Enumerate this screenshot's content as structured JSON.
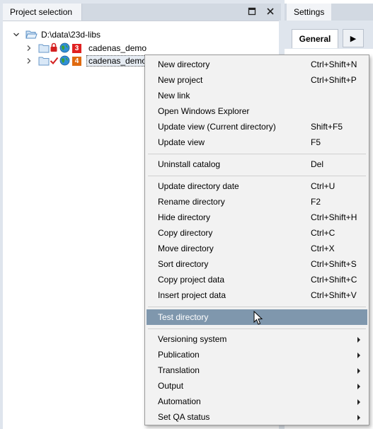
{
  "project_panel": {
    "title": "Project selection",
    "pin_icon": "maximize-icon",
    "close_icon": "close-icon",
    "tree": {
      "root": "D:\\data\\23d-libs",
      "items": [
        {
          "label": "cadenas_demo",
          "badge": "3",
          "badge_color": "#e02020"
        },
        {
          "label": "cadenas_demo",
          "badge": "4",
          "badge_color": "#e06a10"
        }
      ]
    }
  },
  "settings_panel": {
    "title": "Settings",
    "tab_general": "General",
    "tab_more": "▶"
  },
  "context_menu": {
    "group1": [
      {
        "label": "New directory",
        "shortcut": "Ctrl+Shift+N"
      },
      {
        "label": "New project",
        "shortcut": "Ctrl+Shift+P"
      },
      {
        "label": "New link",
        "shortcut": ""
      },
      {
        "label": "Open Windows Explorer",
        "shortcut": ""
      },
      {
        "label": "Update view (Current directory)",
        "shortcut": "Shift+F5"
      },
      {
        "label": "Update view",
        "shortcut": "F5"
      }
    ],
    "group2": [
      {
        "label": "Uninstall catalog",
        "shortcut": "Del"
      }
    ],
    "group3": [
      {
        "label": "Update directory date",
        "shortcut": "Ctrl+U"
      },
      {
        "label": "Rename directory",
        "shortcut": "F2"
      },
      {
        "label": "Hide directory",
        "shortcut": "Ctrl+Shift+H"
      },
      {
        "label": "Copy directory",
        "shortcut": "Ctrl+C"
      },
      {
        "label": "Move directory",
        "shortcut": "Ctrl+X"
      },
      {
        "label": "Sort directory",
        "shortcut": "Ctrl+Shift+S"
      },
      {
        "label": "Copy project data",
        "shortcut": "Ctrl+Shift+C"
      },
      {
        "label": "Insert project data",
        "shortcut": "Ctrl+Shift+V"
      }
    ],
    "group4": [
      {
        "label": "Test directory",
        "shortcut": ""
      }
    ],
    "group5": [
      {
        "label": "Versioning system"
      },
      {
        "label": "Publication"
      },
      {
        "label": "Translation"
      },
      {
        "label": "Output"
      },
      {
        "label": "Automation"
      },
      {
        "label": "Set QA status"
      }
    ]
  },
  "colors": {
    "highlight": "#7f97ad",
    "menu_bg": "#f2f2f2",
    "panel_bg": "#dfe5ed"
  }
}
